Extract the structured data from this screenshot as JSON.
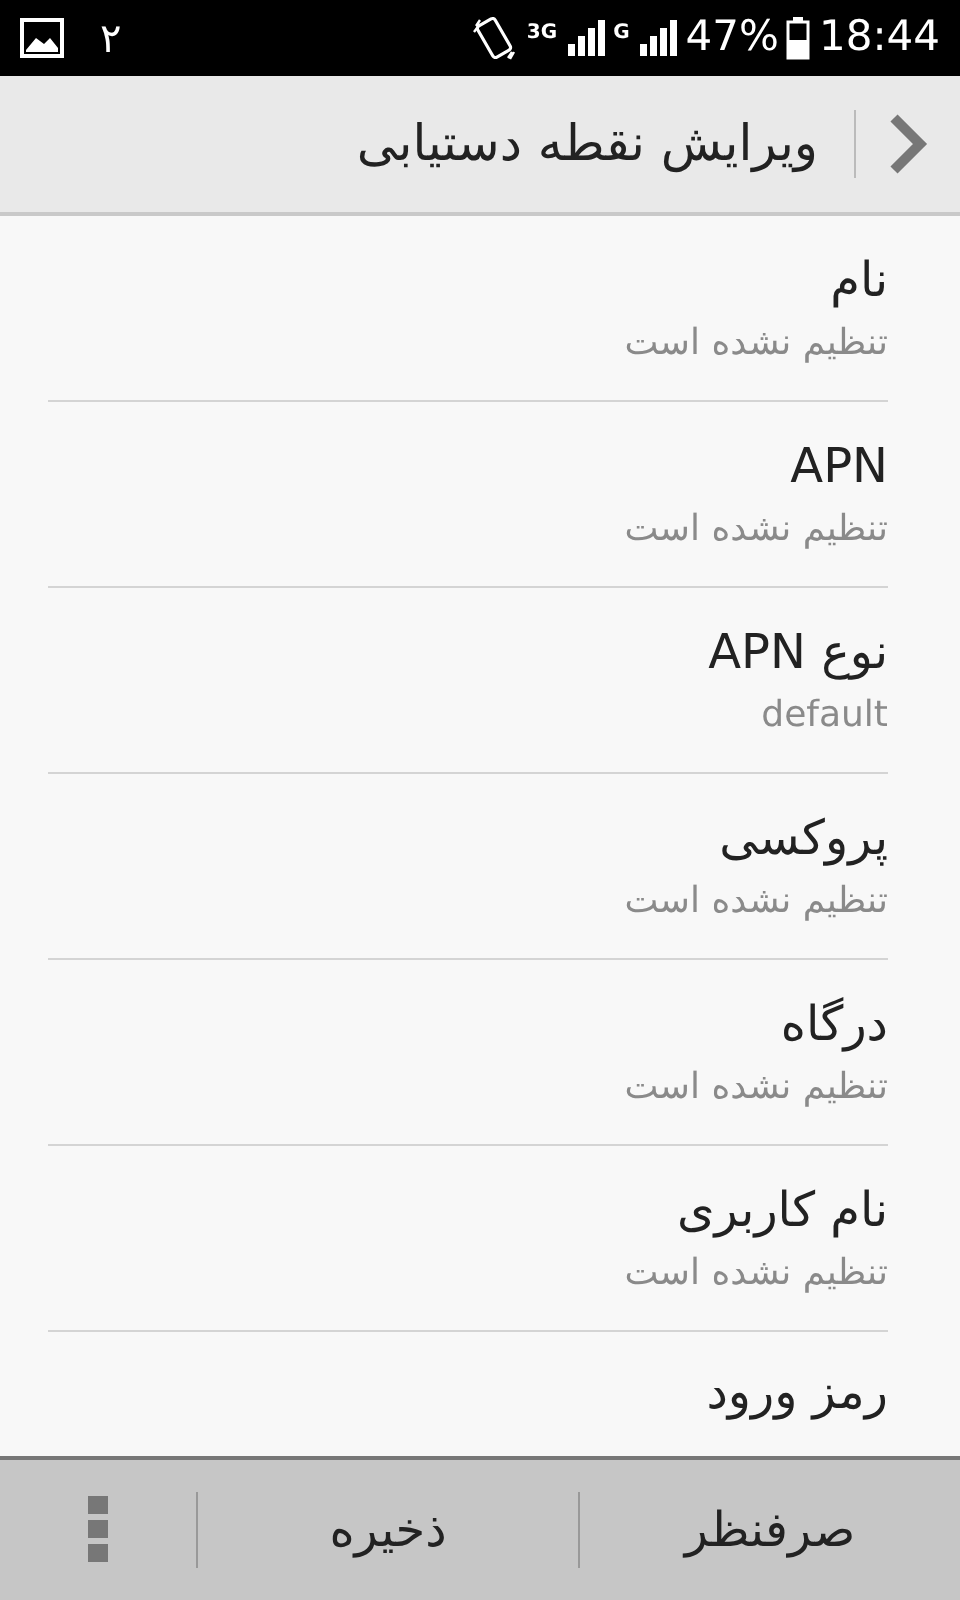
{
  "status_bar": {
    "notification_count": "۲",
    "network_1": "3G",
    "network_2": "G",
    "battery": "47%",
    "time": "18:44"
  },
  "action_bar": {
    "title": "ویرایش نقطه دستیابی"
  },
  "items": [
    {
      "title": "نام",
      "summary": "تنظیم نشده است"
    },
    {
      "title": "APN",
      "summary": "تنظیم نشده است"
    },
    {
      "title": "نوع APN",
      "summary": "default"
    },
    {
      "title": "پروکسی",
      "summary": "تنظیم نشده است"
    },
    {
      "title": "درگاه",
      "summary": "تنظیم نشده است"
    },
    {
      "title": "نام کاربری",
      "summary": "تنظیم نشده است"
    },
    {
      "title": "رمز ورود"
    }
  ],
  "bottom_bar": {
    "buttons": [
      "صرفنظر",
      "ذخیره"
    ]
  }
}
